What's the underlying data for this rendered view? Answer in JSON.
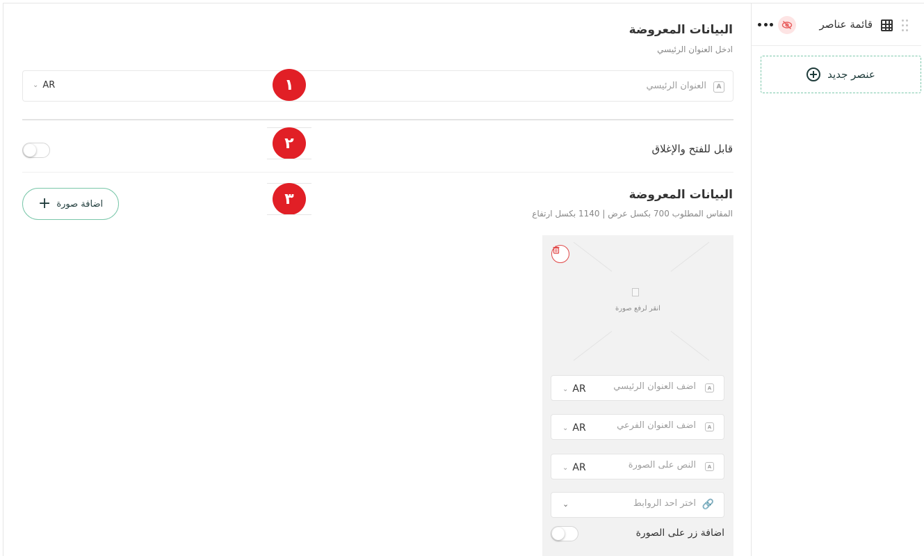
{
  "sidebar": {
    "title": "قائمة عناصر",
    "new_item_label": "عنصر جديد"
  },
  "section_main": {
    "title": "البيانات المعروضة",
    "subtitle": "ادخل العنوان الرئيسي",
    "field_placeholder": "العنوان الرئيسي",
    "field_icon_letter": "A",
    "language": "AR"
  },
  "section_toggle": {
    "label": "قابل للفتح والإغلاق",
    "enabled": false
  },
  "section_images": {
    "title": "البيانات المعروضة",
    "subtitle": "المقاس المطلوب 700 بكسل عرض | 1140 بكسل ارتفاع",
    "add_button_label": "اضافة صورة",
    "card": {
      "upload_text": "انقر لرفع صورة",
      "fields": [
        {
          "placeholder": "اضف العنوان الرئيسي",
          "language": "AR",
          "icon": "A"
        },
        {
          "placeholder": "اضف العنوان الفرعي",
          "language": "AR",
          "icon": "A"
        },
        {
          "placeholder": "النص على الصورة",
          "language": "AR",
          "icon": "A"
        }
      ],
      "link_placeholder": "اختر احد الروابط",
      "button_toggle_label": "اضافة زر على الصورة",
      "button_toggle_enabled": false
    }
  },
  "badges": [
    "١",
    "٢",
    "٣"
  ],
  "colors": {
    "accent": "#7ac7aa",
    "badge": "#e11f26",
    "danger": "#e04848",
    "dark_text": "#1e3b3a"
  }
}
